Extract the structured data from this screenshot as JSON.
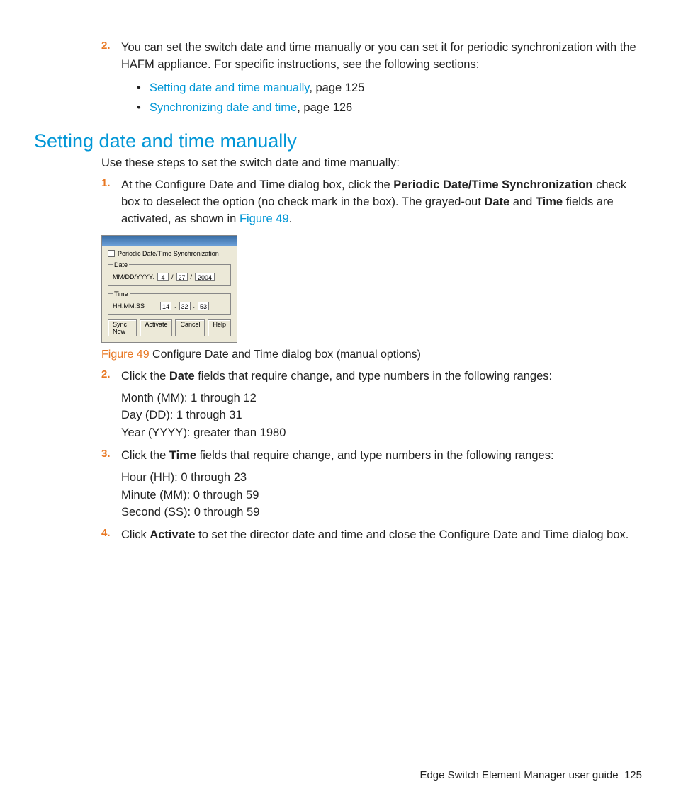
{
  "intro_item": {
    "num": "2.",
    "text": "You can set the switch date and time manually or you can set it for periodic synchronization with the HAFM appliance. For specific instructions, see the following sections:",
    "bullets": [
      {
        "link": "Setting date and time manually",
        "suffix": ", page 125"
      },
      {
        "link": "Synchronizing date and time",
        "suffix": ", page 126"
      }
    ]
  },
  "section_title": "Setting date and time manually",
  "section_intro": "Use these steps to set the switch date and time manually:",
  "step1": {
    "num": "1.",
    "pre": "At the Configure Date and Time dialog box, click the ",
    "bold1": "Periodic Date/Time Synchronization",
    "mid1": " check box to deselect the option (no check mark in the box). The grayed-out ",
    "bold2": "Date",
    "and": " and ",
    "bold3": "Time",
    "mid2": " fields are activated, as shown in ",
    "link": "Figure 49",
    "period": "."
  },
  "dialog": {
    "chk_label": "Periodic Date/Time Synchronization",
    "date_legend": "Date",
    "date_label": "MM/DD/YYYY:",
    "mm": "4",
    "dd": "27",
    "yyyy": "2004",
    "time_legend": "Time",
    "time_label": "HH:MM:SS",
    "hh": "14",
    "mi": "32",
    "ss": "53",
    "btn_sync": "Sync Now",
    "btn_activate": "Activate",
    "btn_cancel": "Cancel",
    "btn_help": "Help",
    "sep_slash": "/",
    "sep_colon": ":"
  },
  "figure": {
    "label": "Figure 49",
    "caption": " Configure Date and Time dialog box (manual options)"
  },
  "step2": {
    "num": "2.",
    "pre": "Click the ",
    "bold": "Date",
    "post": " fields that require change, and type numbers in the following ranges:",
    "r1": "Month (MM): 1 through 12",
    "r2": "Day (DD): 1 through 31",
    "r3": "Year (YYYY): greater than 1980"
  },
  "step3": {
    "num": "3.",
    "pre": "Click the ",
    "bold": "Time",
    "post": " fields that require change, and type numbers in the following ranges:",
    "r1": "Hour (HH): 0 through 23",
    "r2": "Minute (MM): 0 through 59",
    "r3": "Second (SS): 0 through 59"
  },
  "step4": {
    "num": "4.",
    "pre": "Click ",
    "bold": "Activate",
    "post": " to set the director date and time and close the Configure Date and Time dialog box."
  },
  "footer": {
    "title": "Edge Switch Element Manager user guide",
    "page": "125"
  }
}
